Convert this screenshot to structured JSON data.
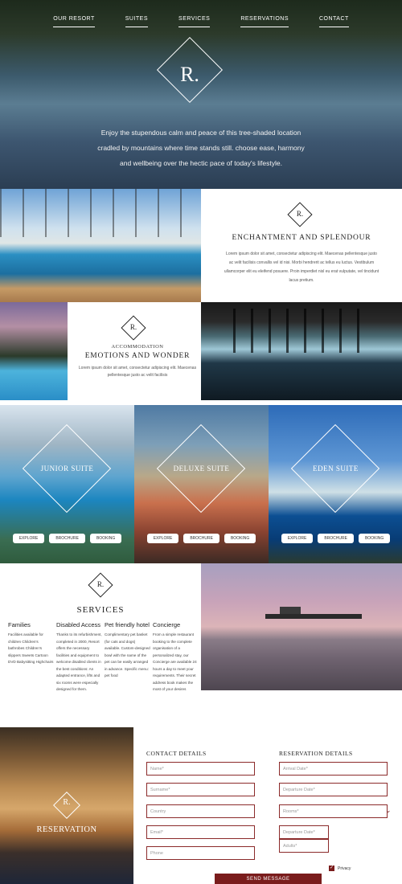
{
  "nav": [
    "OUR RESORT",
    "SUITES",
    "SERVICES",
    "RESERVATIONS",
    "CONTACT"
  ],
  "hero": {
    "logo": "R.",
    "text": "Enjoy the stupendous calm and peace of this tree-shaded location cradled by mountains where time stands still. choose ease, harmony and wellbeing over the hectic pace of today's lifestyle."
  },
  "enchantment": {
    "logo": "R.",
    "title": "ENCHANTMENT AND SPLENDOUR",
    "text": "Lorem ipsum dolor sit amet, consectetur adipiscing elit. Maecenas pellentesque justo ac velit facilisis convallis vel id nisi. Morbi hendrerit ac tellus eu luctus. Vestibulum ullamcorper elit eu eleifend posuere. Proin imperdiet nisl eu erat vulputate, vel tincidunt lacus pretium."
  },
  "accommodation": {
    "logo": "R.",
    "subtitle": "ACCOMMODATION",
    "title": "EMOTIONS AND WONDER",
    "text": "Lorem ipsum dolor sit amet, consectetur adipiscing elit. Maecenas pellentesque justo ac velit facilisis"
  },
  "suites": [
    {
      "name": "JUNIOR SUITE",
      "buttons": [
        "EXPLORE",
        "BROCHURE",
        "BOOKING"
      ]
    },
    {
      "name": "DELUXE SUITE",
      "buttons": [
        "EXPLORE",
        "BROCHURE",
        "BOOKING"
      ]
    },
    {
      "name": "EDEN SUITE",
      "buttons": [
        "EXPLORE",
        "BROCHURE",
        "BOOKING"
      ]
    }
  ],
  "services": {
    "logo": "R.",
    "title": "SERVICES",
    "columns": [
      {
        "heading": "Families",
        "text": "Facilities available for children Children's bathrobes Children's slippers Sweets Cartoon DVD Babysitting Highchairs"
      },
      {
        "heading": "Disabled Access",
        "text": "Thanks to its refurbishment, completed in 2000, Resort offers the necessary facilities and equipment to welcome disabled clients in the best conditions: An adapted entrance, lifts and six rooms were especially designed for them."
      },
      {
        "heading": "Pet friendly hotel",
        "text": "Complimentary pet basket (for cats and dogs) available. Custom-designed bowl with the name of the pet can be easily arranged in advance. Specific menu: pet food"
      },
      {
        "heading": "Concierge",
        "text": "From a simple restaurant booking to the complete organisation of a personalized stay, our Concierge are available 24 hours a day to meet your requirements. Their secret address book makes the most of your desires"
      }
    ]
  },
  "reservation": {
    "logo": "R.",
    "label": "RESERVATION",
    "contact_heading": "CONTACT DETAILS",
    "reservation_heading": "RESERVATION DETAILS",
    "contact_fields": [
      "Name*",
      "Surname*",
      "Country",
      "Email*",
      "Phone"
    ],
    "reservation_fields": [
      "Arrival Date*",
      "Departure Date*",
      "Rooms*",
      "Departure Date*",
      "Adults*"
    ],
    "privacy": "Privacy",
    "send": "SEND MESSAGE"
  },
  "colors": {
    "accent": "#7a1c1c",
    "field_border": "#8b2a2a"
  }
}
